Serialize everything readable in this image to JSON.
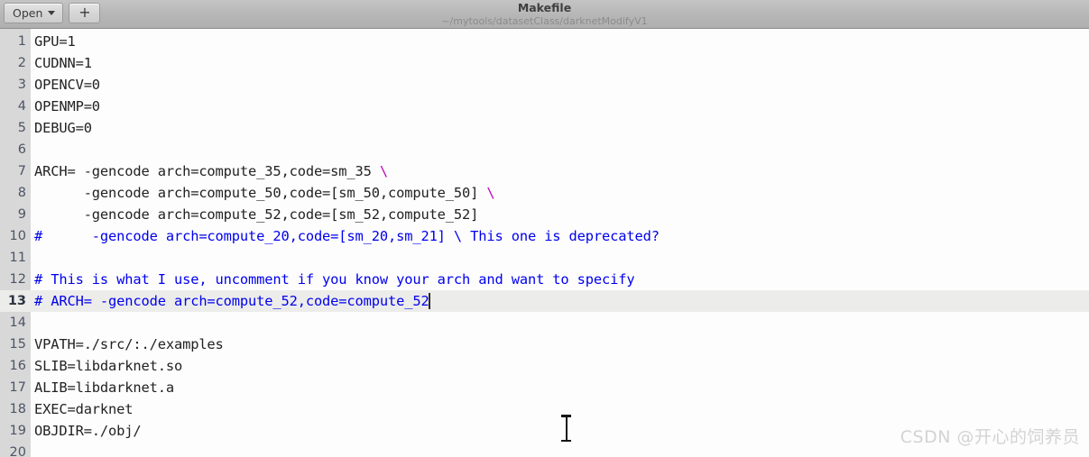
{
  "header": {
    "open_label": "Open",
    "new_tab_label": "+",
    "title": "Makefile",
    "subtitle": "~/mytools/datasetClass/darknetModifyV1"
  },
  "editor": {
    "current_line": 13,
    "lines": [
      {
        "n": "1",
        "segments": [
          {
            "t": "GPU=1",
            "c": "plain"
          }
        ]
      },
      {
        "n": "2",
        "segments": [
          {
            "t": "CUDNN=1",
            "c": "plain"
          }
        ]
      },
      {
        "n": "3",
        "segments": [
          {
            "t": "OPENCV=0",
            "c": "plain"
          }
        ]
      },
      {
        "n": "4",
        "segments": [
          {
            "t": "OPENMP=0",
            "c": "plain"
          }
        ]
      },
      {
        "n": "5",
        "segments": [
          {
            "t": "DEBUG=0",
            "c": "plain"
          }
        ]
      },
      {
        "n": "6",
        "segments": [
          {
            "t": "",
            "c": "plain"
          }
        ]
      },
      {
        "n": "7",
        "segments": [
          {
            "t": "ARCH= -gencode arch=compute_35,code=sm_35 ",
            "c": "plain"
          },
          {
            "t": "\\",
            "c": "esc"
          }
        ]
      },
      {
        "n": "8",
        "segments": [
          {
            "t": "      -gencode arch=compute_50,code=[sm_50,compute_50] ",
            "c": "plain"
          },
          {
            "t": "\\",
            "c": "esc"
          }
        ]
      },
      {
        "n": "9",
        "segments": [
          {
            "t": "      -gencode arch=compute_52,code=[sm_52,compute_52]",
            "c": "plain"
          }
        ]
      },
      {
        "n": "10",
        "segments": [
          {
            "t": "#      -gencode arch=compute_20,code=[sm_20,sm_21] \\ This one is deprecated?",
            "c": "cmt"
          }
        ]
      },
      {
        "n": "11",
        "segments": [
          {
            "t": "",
            "c": "plain"
          }
        ]
      },
      {
        "n": "12",
        "segments": [
          {
            "t": "# This is what I use, uncomment if you know your arch and want to specify",
            "c": "cmt"
          }
        ]
      },
      {
        "n": "13",
        "segments": [
          {
            "t": "# ARCH= -gencode arch=compute_52,code=compute_52",
            "c": "cmt"
          }
        ],
        "caret": true
      },
      {
        "n": "14",
        "segments": [
          {
            "t": "",
            "c": "plain"
          }
        ]
      },
      {
        "n": "15",
        "segments": [
          {
            "t": "VPATH=./src/:./examples",
            "c": "plain"
          }
        ]
      },
      {
        "n": "16",
        "segments": [
          {
            "t": "SLIB=libdarknet.so",
            "c": "plain"
          }
        ]
      },
      {
        "n": "17",
        "segments": [
          {
            "t": "ALIB=libdarknet.a",
            "c": "plain"
          }
        ]
      },
      {
        "n": "18",
        "segments": [
          {
            "t": "EXEC=darknet",
            "c": "plain"
          }
        ]
      },
      {
        "n": "19",
        "segments": [
          {
            "t": "OBJDIR=./obj/",
            "c": "plain"
          }
        ]
      },
      {
        "n": "20",
        "segments": [
          {
            "t": "",
            "c": "plain"
          }
        ]
      }
    ]
  },
  "watermark": {
    "text": "CSDN @开心的饲养员"
  },
  "colors": {
    "comment": "#0000ee",
    "line_continuation": "#c000c0",
    "gutter_bg": "#d8d8d8",
    "current_line_bg": "#ececea",
    "editor_bg": "#fdfdfd",
    "headerbar_bg": "#b6b6b6"
  }
}
